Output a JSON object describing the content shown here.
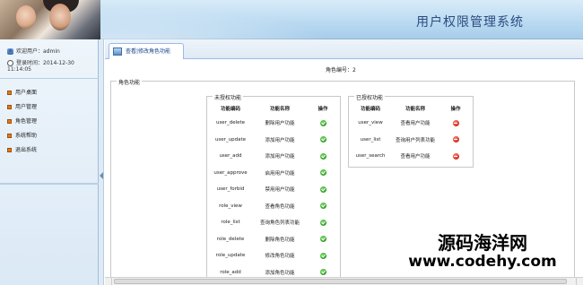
{
  "header": {
    "system_title": "用户权限管理系统"
  },
  "user": {
    "welcome": "欢迎用户：admin",
    "login_time": "登录时间：2014-12-30",
    "login_time_cont": "11:14:05"
  },
  "menu": [
    {
      "label": "用户桌面"
    },
    {
      "label": "用户管理"
    },
    {
      "label": "角色管理"
    },
    {
      "label": "系统帮助"
    },
    {
      "label": "退出系统"
    }
  ],
  "tab": {
    "label": "查看|修改角色功能"
  },
  "role": {
    "number_text": "角色编号：2"
  },
  "fieldset": {
    "legend": "角色功能"
  },
  "unauthorized": {
    "legend": "未授权功能",
    "headers": [
      "功能编码",
      "功能名称",
      "操作"
    ],
    "rows": [
      {
        "code": "user_delete",
        "name": "删除用户功能"
      },
      {
        "code": "user_update",
        "name": "添加用户功能"
      },
      {
        "code": "user_add",
        "name": "添加用户功能"
      },
      {
        "code": "user_approve",
        "name": "启用用户功能"
      },
      {
        "code": "user_forbid",
        "name": "禁用用户功能"
      },
      {
        "code": "role_view",
        "name": "查看角色功能"
      },
      {
        "code": "role_list",
        "name": "查询角色列表功能"
      },
      {
        "code": "role_delete",
        "name": "删除角色功能"
      },
      {
        "code": "role_update",
        "name": "修改角色功能"
      },
      {
        "code": "role_add",
        "name": "添加角色功能"
      }
    ]
  },
  "authorized": {
    "legend": "已授权功能",
    "headers": [
      "功能编码",
      "功能名称",
      "操作"
    ],
    "rows": [
      {
        "code": "user_view",
        "name": "查看用户功能"
      },
      {
        "code": "user_list",
        "name": "查询用户列表功能"
      },
      {
        "code": "user_search",
        "name": "查看用户功能"
      }
    ]
  },
  "watermark": {
    "line1": "源码海洋网",
    "line2": "www.codehy.com"
  },
  "colors": {
    "accent": "#15428b",
    "add": "#2f9b25",
    "remove": "#d2261a",
    "menu_bullet": "#e07b1c"
  }
}
